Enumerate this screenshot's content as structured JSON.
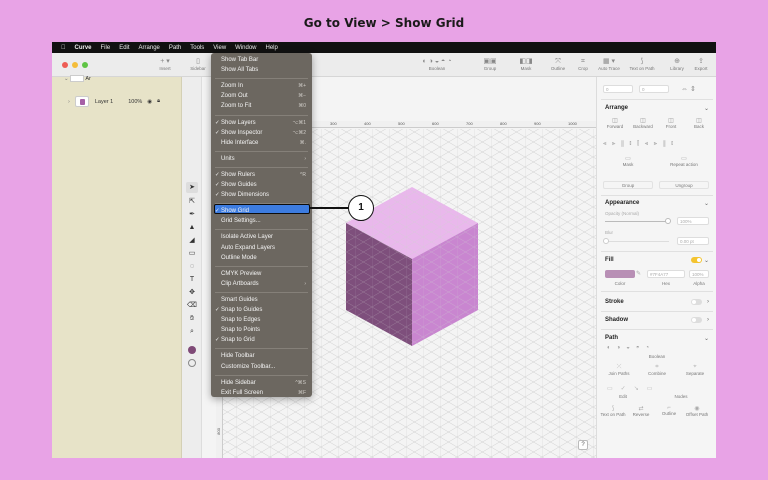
{
  "instruction": "Go to View > Show Grid",
  "menubar": {
    "app": "Curve",
    "items": [
      "File",
      "Edit",
      "Arrange",
      "Path",
      "Tools",
      "View",
      "Window",
      "Help"
    ]
  },
  "toolbar": {
    "insert": "Insert",
    "sidebar": "Sidebar",
    "boolean": "Boolean",
    "group": "Group",
    "mask": "Mask",
    "outline": "Outline",
    "crop": "Crop",
    "auto_trace": "Auto Trace",
    "text_on_path": "Text on Path",
    "library": "Library",
    "export": "Export"
  },
  "layers": {
    "artboard": "Ar",
    "layer1": "Layer 1",
    "opacity": "100%"
  },
  "ruler": {
    "ticks": [
      "300",
      "400",
      "500",
      "600",
      "700",
      "800",
      "900",
      "1000"
    ],
    "v_label": "800"
  },
  "help": "?",
  "view_menu": {
    "items": [
      {
        "label": "Show Tab Bar",
        "shortcut": "",
        "checked": false
      },
      {
        "label": "Show All Tabs",
        "shortcut": "",
        "checked": false
      },
      {
        "label": "Zoom In",
        "shortcut": "⌘+",
        "checked": false
      },
      {
        "label": "Zoom Out",
        "shortcut": "⌘−",
        "checked": false
      },
      {
        "label": "Zoom to Fit",
        "shortcut": "⌘0",
        "checked": false
      },
      {
        "label": "Show Layers",
        "shortcut": "⌥⌘1",
        "checked": true
      },
      {
        "label": "Show Inspector",
        "shortcut": "⌥⌘2",
        "checked": true
      },
      {
        "label": "Hide Interface",
        "shortcut": "⌘.",
        "checked": false
      },
      {
        "label": "Units",
        "shortcut": "›",
        "checked": false
      },
      {
        "label": "Show Rulers",
        "shortcut": "^R",
        "checked": true
      },
      {
        "label": "Show Guides",
        "shortcut": "",
        "checked": true
      },
      {
        "label": "Show Dimensions",
        "shortcut": "",
        "checked": true
      },
      {
        "label": "Show Grid",
        "shortcut": "",
        "checked": true
      },
      {
        "label": "Grid Settings...",
        "shortcut": "",
        "checked": false
      },
      {
        "label": "Isolate Active Layer",
        "shortcut": "",
        "checked": false
      },
      {
        "label": "Auto Expand Layers",
        "shortcut": "",
        "checked": false
      },
      {
        "label": "Outline Mode",
        "shortcut": "",
        "checked": false
      },
      {
        "label": "CMYK Preview",
        "shortcut": "",
        "checked": false
      },
      {
        "label": "Clip Artboards",
        "shortcut": "›",
        "checked": false
      },
      {
        "label": "Smart Guides",
        "shortcut": "",
        "checked": false
      },
      {
        "label": "Snap to Guides",
        "shortcut": "",
        "checked": true
      },
      {
        "label": "Snap to Edges",
        "shortcut": "",
        "checked": false
      },
      {
        "label": "Snap to Points",
        "shortcut": "",
        "checked": false
      },
      {
        "label": "Snap to Grid",
        "shortcut": "",
        "checked": true
      },
      {
        "label": "Hide Toolbar",
        "shortcut": "",
        "checked": false
      },
      {
        "label": "Customize Toolbar...",
        "shortcut": "",
        "checked": false
      },
      {
        "label": "Hide Sidebar",
        "shortcut": "^⌘S",
        "checked": false
      },
      {
        "label": "Exit Full Screen",
        "shortcut": "⌘F",
        "checked": false
      }
    ]
  },
  "callout": "1",
  "inspector": {
    "x": "0",
    "y": "0",
    "arrange": "Arrange",
    "forward": "Forward",
    "backward": "Backward",
    "front": "Front",
    "back": "Back",
    "mask": "Mask",
    "repeat_action": "Repeat action",
    "group": "Group",
    "ungroup": "Ungroup",
    "appearance": "Appearance",
    "opacity_label": "Opacity (Normal)",
    "opacity_value": "100%",
    "blur_label": "Blur",
    "blur_value": "0.00 pt",
    "fill": "Fill",
    "fill_hex": "#7F4A77",
    "fill_alpha": "100%",
    "color": "Color",
    "hex": "Hex",
    "alpha": "Alpha",
    "stroke": "Stroke",
    "shadow": "Shadow",
    "path": "Path",
    "boolean": "Boolean",
    "join_paths": "Join Paths",
    "combine": "Combine",
    "separate": "Separate",
    "edit": "Edit",
    "nodes": "Nodes",
    "text_on_path": "Text on Path",
    "reverse": "Reverse",
    "outline": "Outline",
    "offset_path": "Offset Path"
  },
  "colors": {
    "accent": "#3d7ce0",
    "fill_swatch": "#7f4a77",
    "cube_top": "#e9b8ec",
    "cube_left": "#7e4f7c",
    "cube_right": "#c986d0",
    "background": "#e8a3e6"
  }
}
